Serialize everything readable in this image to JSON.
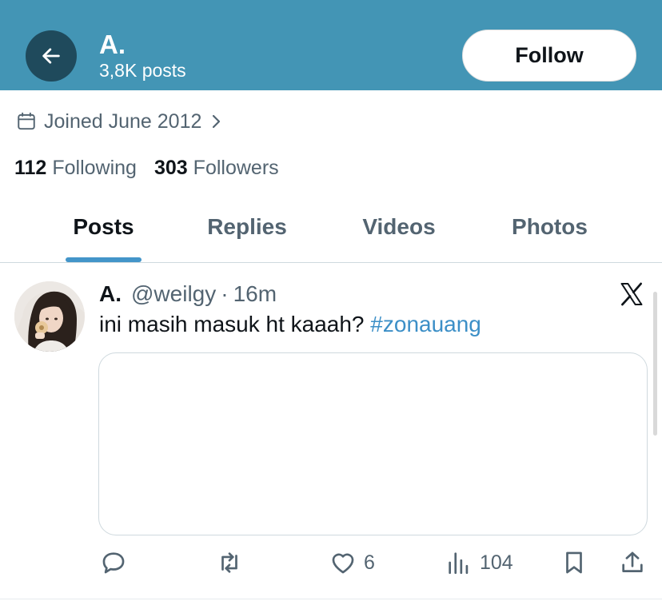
{
  "header": {
    "name": "A.",
    "posts_count": "3,8K posts",
    "follow_label": "Follow",
    "background_color": "#4395b5"
  },
  "profile": {
    "joined": "Joined June 2012",
    "following_count": "112",
    "following_label": "Following",
    "followers_count": "303",
    "followers_label": "Followers"
  },
  "tabs": [
    {
      "label": "Posts",
      "active": true
    },
    {
      "label": "Replies",
      "active": false
    },
    {
      "label": "Videos",
      "active": false
    },
    {
      "label": "Photos",
      "active": false
    }
  ],
  "post": {
    "author": "A.",
    "handle": "@weilgy",
    "separator": "·",
    "time": "16m",
    "text": "ini masih masuk ht kaaah?",
    "hashtag": "#zonauang",
    "likes": "6",
    "views": "104"
  },
  "icons": {
    "back": "arrow-left-icon",
    "calendar": "calendar-icon",
    "chevron": "chevron-right-icon",
    "x_logo": "x-logo-icon",
    "reply": "reply-icon",
    "repost": "repost-icon",
    "like": "heart-icon",
    "views": "views-icon",
    "bookmark": "bookmark-icon",
    "share": "share-icon"
  },
  "colors": {
    "accent": "#4395c9",
    "hashtag": "#3c8fc7",
    "secondary_text": "#536471"
  }
}
